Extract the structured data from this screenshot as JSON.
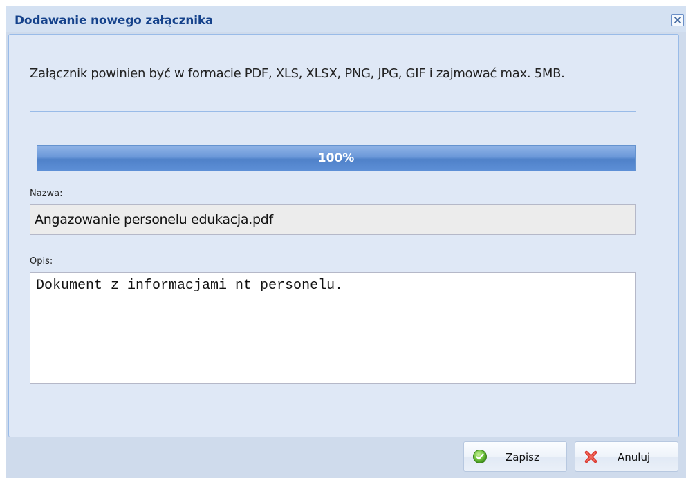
{
  "dialog": {
    "title": "Dodawanie nowego załącznika",
    "close_icon": "close-icon"
  },
  "info": {
    "text": "Załącznik powinien być w formacie PDF, XLS, XLSX, PNG, JPG, GIF i zajmować max. 5MB."
  },
  "progress": {
    "value": 1.0,
    "label": "100%"
  },
  "name_field": {
    "label": "Nazwa:",
    "value": "Angazowanie personelu edukacja.pdf"
  },
  "description_field": {
    "label": "Opis:",
    "value": "Dokument z informacjami nt personelu."
  },
  "buttons": {
    "save": {
      "label": "Zapisz",
      "icon": "check-circle-icon"
    },
    "cancel": {
      "label": "Anuluj",
      "icon": "red-x-icon"
    }
  },
  "colors": {
    "title_text": "#15428b",
    "window_bg": "#cfdbec",
    "panel_bg": "#dfe8f6",
    "border": "#99bbe8",
    "progress_fill": "#5d8fd6"
  }
}
